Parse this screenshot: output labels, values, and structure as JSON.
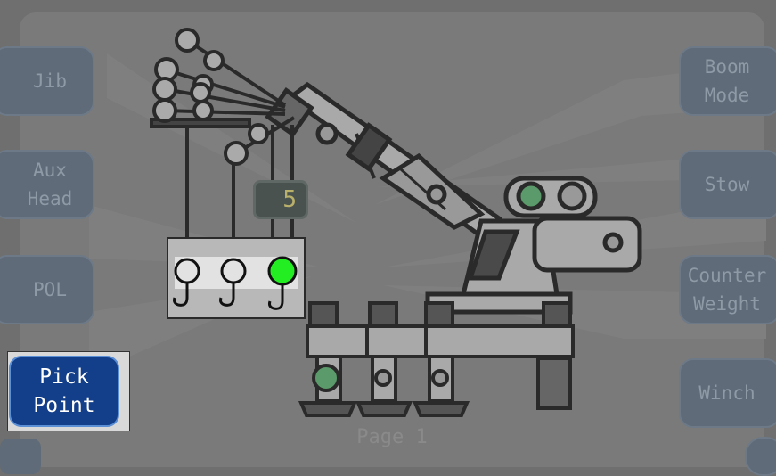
{
  "left_buttons": [
    {
      "label": "Jib"
    },
    {
      "label": "Aux\nHead"
    },
    {
      "label": "POL"
    }
  ],
  "pick_point": {
    "label": "Pick\nPoint"
  },
  "right_buttons": [
    {
      "label": "Boom\nMode"
    },
    {
      "label": "Stow"
    },
    {
      "label": "Counter\nWeight"
    },
    {
      "label": "Winch"
    }
  ],
  "hook_count": "5",
  "page_label": "Page 1",
  "colors": {
    "active_green": "#22ee22",
    "inactive_green": "#5b9a6a",
    "selected_button": "#123e8a",
    "button": "#5f6b78"
  },
  "icons": [
    "home-icon",
    "menu-icon"
  ]
}
